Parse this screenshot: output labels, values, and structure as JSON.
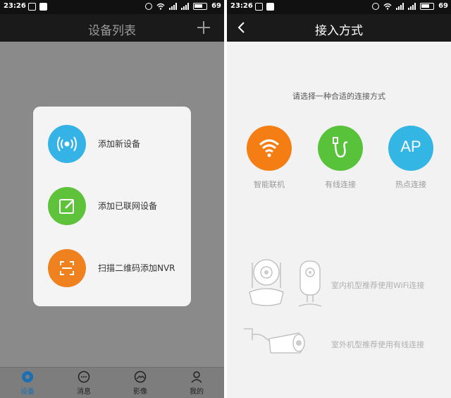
{
  "left_screen": {
    "status": {
      "time": "23:26",
      "battery": "69"
    },
    "header": {
      "title": "设备列表"
    },
    "popup_items": [
      {
        "label": "添加新设备",
        "icon": "broadcast-icon",
        "color": "#36b3e6"
      },
      {
        "label": "添加已联网设备",
        "icon": "edit-icon",
        "color": "#5ec23a"
      },
      {
        "label": "扫描二维码添加NVR",
        "icon": "scan-icon",
        "color": "#f0811f"
      }
    ],
    "nav": [
      {
        "label": "设备",
        "icon": "device-icon"
      },
      {
        "label": "消息",
        "icon": "message-icon"
      },
      {
        "label": "影像",
        "icon": "image-icon"
      },
      {
        "label": "我的",
        "icon": "user-icon"
      }
    ]
  },
  "right_screen": {
    "status": {
      "time": "23:26",
      "battery": "69"
    },
    "header": {
      "title": "接入方式"
    },
    "prompt": "请选择一种合适的连接方式",
    "methods": [
      {
        "label": "智能联机",
        "icon": "wifi-icon",
        "color": "#f57e14"
      },
      {
        "label": "有线连接",
        "icon": "cable-icon",
        "color": "#58c23a"
      },
      {
        "label": "热点连接",
        "icon_text": "AP",
        "color": "#33b6e3"
      }
    ],
    "notes": {
      "indoor": "室内机型推荐使用WiFi连接",
      "outdoor": "室外机型推荐使用有线连接"
    }
  }
}
